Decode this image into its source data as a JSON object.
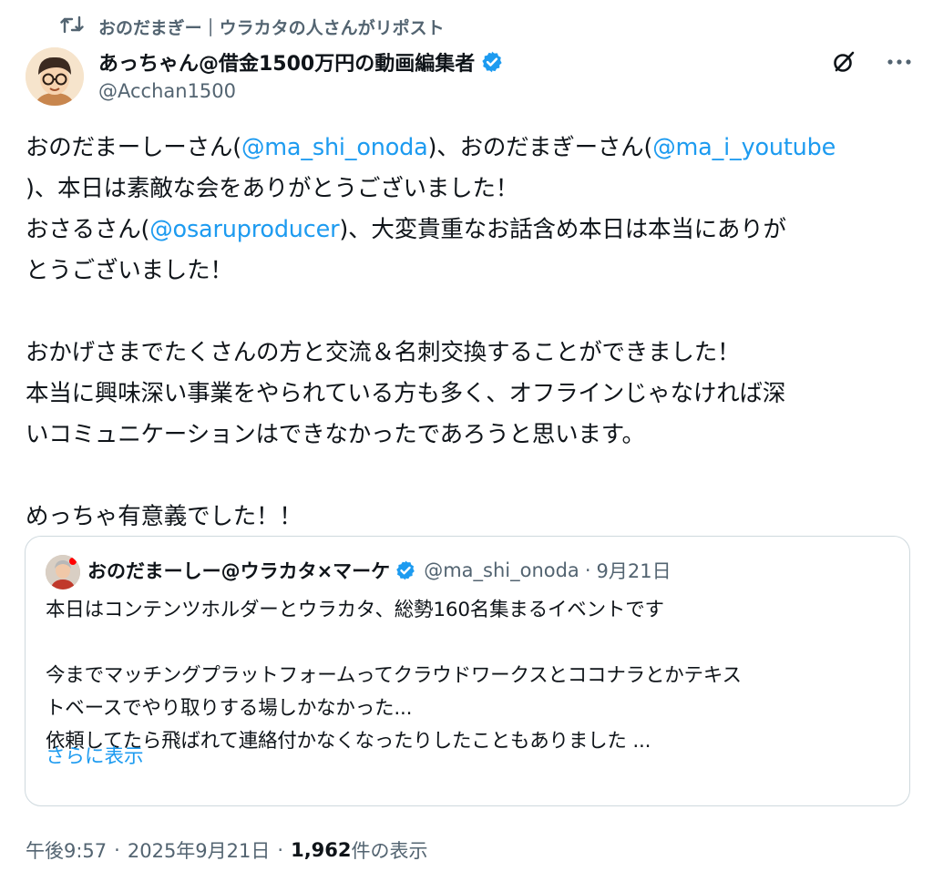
{
  "repost": {
    "icon": "repost-icon",
    "text": "おのだまぎー｜ウラカタの人さんがリポスト"
  },
  "author": {
    "name": "あっちゃん@借金1500万円の動画編集者",
    "handle": "@Acchan1500",
    "verified": true
  },
  "top_actions": {
    "grok_icon": "grok-icon",
    "more_icon": "more-icon"
  },
  "tweet": {
    "p1_a": "おのだまーしーさん(",
    "mention1": "@ma_shi_onoda",
    "p1_b": ")、おのだまぎーさん(",
    "mention2": "@ma_i_youtube",
    "p1_c": "\n)、本日は素敵な会をありがとうございました！\nおさるさん(",
    "mention3": "@osaruproducer",
    "p1_d": ")、大変貴重なお話含め本日は本当にありが\nとうございました！\n\nおかげさまでたくさんの方と交流＆名刺交換することができました！\n本当に興味深い事業をやられている方も多く、オフラインじゃなければ深\nいコミュニケーションはできなかったであろうと思います。\n\nめっちゃ有意義でした！！"
  },
  "quote": {
    "name": "おのだまーしー@ウラカタ×マーケ",
    "handle": "@ma_shi_onoda",
    "dot": "·",
    "date": "9月21日",
    "text": "本日はコンテンツホルダーとウラカタ、総勢160名集まるイベントです\n\n今までマッチングプラットフォームってクラウドワークスとココナラとかテキス\nトベースでやり取りする場しかなかった...\n依頼してたら飛ばれて連絡付かなくなったりしたこともありました ...",
    "show_more": "さらに表示"
  },
  "meta": {
    "time": "午後9:57",
    "dot1": "·",
    "date": "2025年9月21日",
    "dot2": "·",
    "views_count": "1,962",
    "views_label": " 件の表示"
  },
  "colors": {
    "accent": "#1d9bf0",
    "secondary_text": "#536471",
    "border": "#cfd9de"
  }
}
